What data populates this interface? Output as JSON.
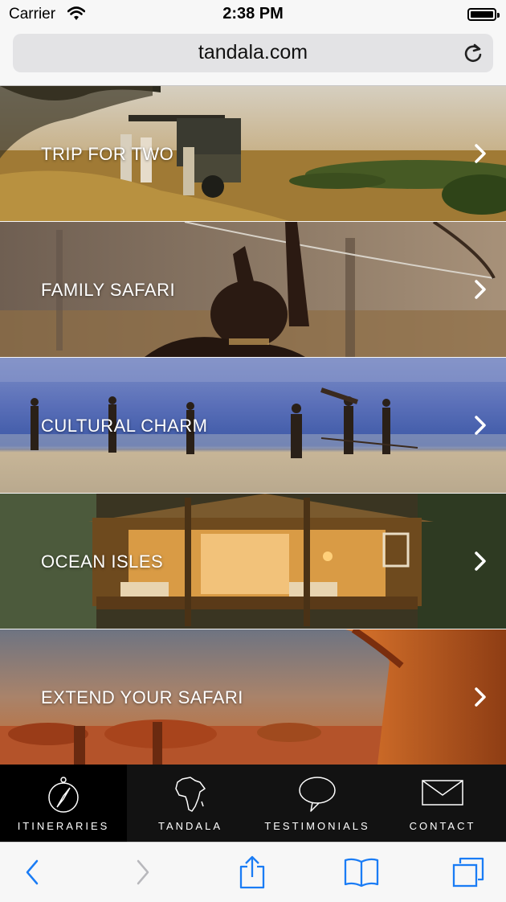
{
  "status_bar": {
    "carrier": "Carrier",
    "time": "2:38 PM"
  },
  "browser": {
    "url": "tandala.com"
  },
  "banners": [
    {
      "label": "TRIP FOR TWO"
    },
    {
      "label": "FAMILY SAFARI"
    },
    {
      "label": "CULTURAL CHARM"
    },
    {
      "label": "OCEAN ISLES"
    },
    {
      "label": "EXTEND YOUR SAFARI"
    }
  ],
  "app_tabs": [
    {
      "label": "ITINERARIES",
      "icon": "compass-icon",
      "active": true
    },
    {
      "label": "TANDALA",
      "icon": "africa-map-icon",
      "active": false
    },
    {
      "label": "TESTIMONIALS",
      "icon": "speech-bubble-icon",
      "active": false
    },
    {
      "label": "CONTACT",
      "icon": "envelope-icon",
      "active": false
    }
  ],
  "safari_toolbar": [
    "back-icon",
    "forward-icon",
    "share-icon",
    "bookmarks-icon",
    "tabs-icon"
  ],
  "colors": {
    "ios_blue": "#1a7cf5",
    "tabbar_bg": "#121212",
    "tab_active_bg": "#000000"
  }
}
